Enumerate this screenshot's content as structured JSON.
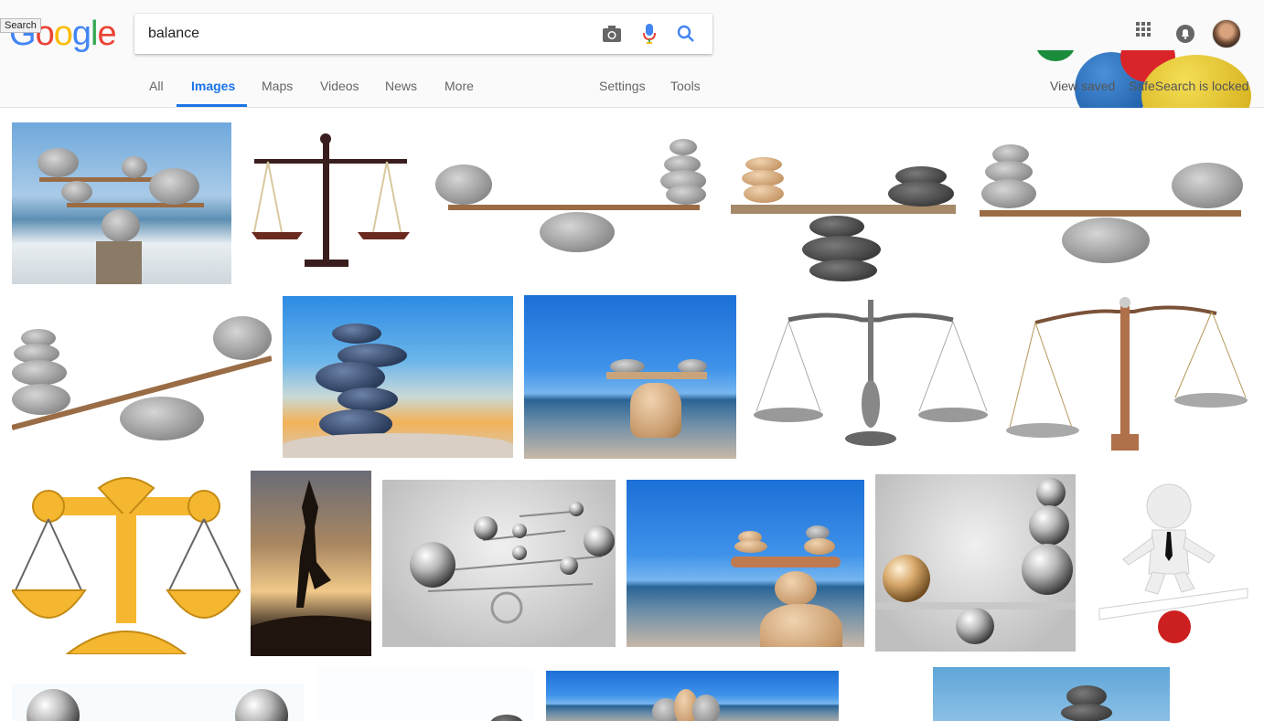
{
  "header": {
    "logo_letters": [
      {
        "ch": "G",
        "color": "#4285f4"
      },
      {
        "ch": "o",
        "color": "#ea4335"
      },
      {
        "ch": "o",
        "color": "#fbbc05"
      },
      {
        "ch": "g",
        "color": "#4285f4"
      },
      {
        "ch": "l",
        "color": "#34a853"
      },
      {
        "ch": "e",
        "color": "#ea4335"
      }
    ],
    "tooltip": "Search",
    "search": {
      "value": "balance"
    },
    "icons": {
      "camera": "camera-icon",
      "mic": "microphone-icon",
      "search": "search-icon",
      "apps": "apps-grid-icon",
      "notifications": "notifications-icon",
      "avatar": "avatar"
    }
  },
  "tabs": {
    "all": "All",
    "images": "Images",
    "maps": "Maps",
    "videos": "Videos",
    "news": "News",
    "more": "More",
    "settings": "Settings",
    "tools": "Tools"
  },
  "right_links": {
    "view_saved": "View saved",
    "safesearch": "SafeSearch is locked"
  },
  "colors": {
    "accent": "#1a73e8",
    "tab_text": "#666666",
    "header_bg": "#fafafa"
  },
  "gallery": {
    "rows": 4,
    "descriptions_visible": false
  }
}
